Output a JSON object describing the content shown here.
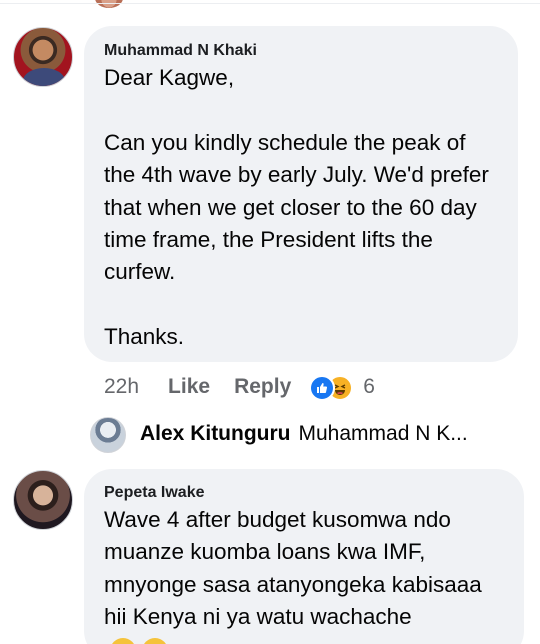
{
  "thread": {
    "comment1": {
      "author": "Muhammad N Khaki",
      "paragraphs": [
        "Dear Kagwe,",
        "",
        "Can you kindly schedule the peak of the 4th wave by early July. We'd prefer that when we get closer to the 60 day time frame, the President lifts the curfew.",
        "",
        "Thanks."
      ],
      "time": "22h",
      "like_label": "Like",
      "reply_label": "Reply",
      "reaction_count": "6",
      "reactions": [
        "like-icon",
        "haha-icon"
      ]
    },
    "reply_preview": {
      "author": "Alex Kitunguru",
      "preview": "Muhammad N K..."
    },
    "comment2": {
      "author": "Pepeta Iwake",
      "lines": [
        "Wave 4 after budget kusomwa ndo",
        "muanze kuomba loans kwa IMF,",
        "mnyonge sasa atanyongeka kabisaaa",
        "hii Kenya ni ya watu wachache"
      ]
    }
  },
  "colors": {
    "bubble": "#f0f2f5",
    "meta_text": "#65676b",
    "like_blue": "#1877f2",
    "haha_yellow": "#f7b125"
  }
}
